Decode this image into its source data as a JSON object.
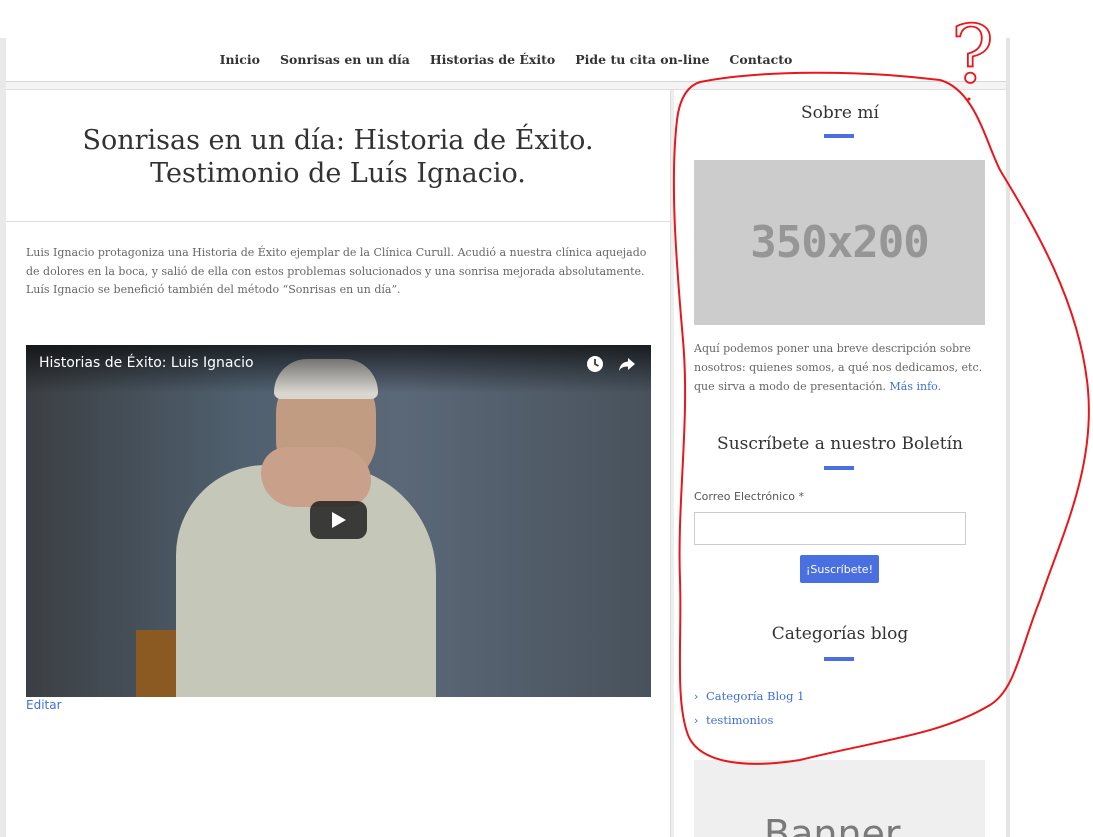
{
  "nav": {
    "items": [
      "Inicio",
      "Sonrisas en un día",
      "Historias de Éxito",
      "Pide tu cita on-line",
      "Contacto"
    ]
  },
  "post": {
    "title_line1": "Sonrisas en un día: Historia de Éxito.",
    "title_line2": "Testimonio de Luís Ignacio.",
    "body": "Luis Ignacio protagoniza una Historia de Éxito ejemplar de la Clínica Curull. Acudió a nuestra clínica aquejado de dolores en la boca, y salió de ella con estos problemas solucionados y una sonrisa mejorada absolutamente. Luís Ignacio se benefició también del método “Sonrisas en un día”.",
    "video_title": "Historias de Éxito: Luis Ignacio",
    "edit_label": "Editar"
  },
  "sidebar": {
    "about": {
      "title": "Sobre mí",
      "image_text": "350x200",
      "text": "Aquí podemos poner una breve descripción sobre nosotros: quienes somos, a qué nos dedicamos, etc. que sirva a modo de presentación. ",
      "link": "Más info."
    },
    "newsletter": {
      "title": "Suscríbete a nuestro Boletín",
      "email_label": "Correo Electrónico *",
      "email_value": "",
      "button": "¡Suscríbete!"
    },
    "categories": {
      "title": "Categorías blog",
      "items": [
        "Categoría Blog 1",
        "testimonios"
      ]
    },
    "banner": {
      "text": "Banner"
    }
  },
  "annotation": {
    "mark": "?",
    "color": "#e8171b"
  },
  "colors": {
    "accent": "#4a6fe0",
    "link": "#3f6fd9",
    "annotation": "#e8171b"
  }
}
